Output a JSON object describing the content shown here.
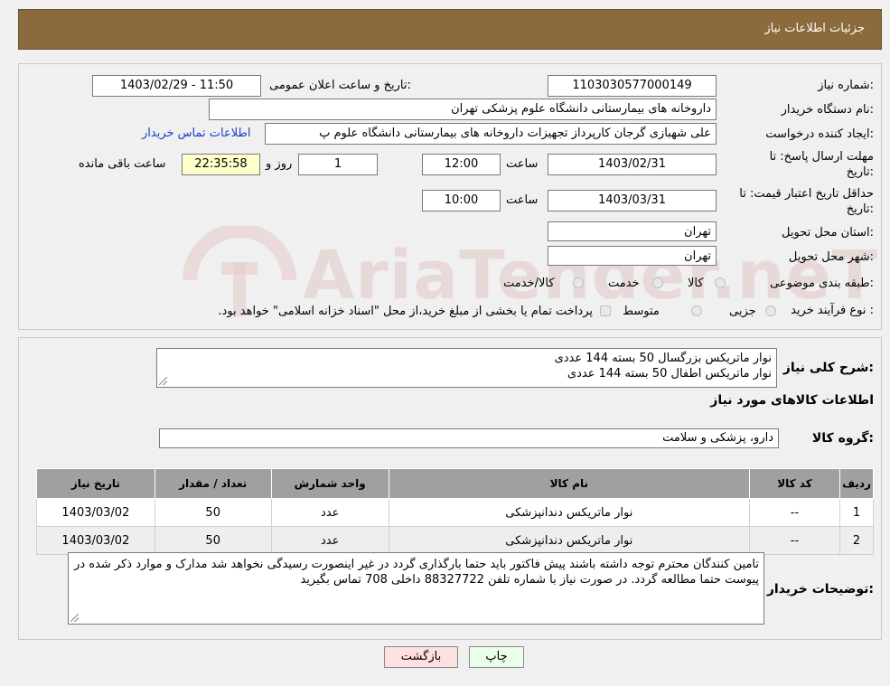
{
  "header": {
    "title": "جزئیات اطلاعات نیاز"
  },
  "form": {
    "need_number_label": "شماره نیاز:",
    "need_number": "1103030577000149",
    "announce_label": "تاریخ و ساعت اعلان عمومی:",
    "announce_value": "1403/02/29 - 11:50",
    "buyer_org_label": "نام دستگاه خریدار:",
    "buyer_org": "داروخانه های بیمارستانی دانشگاه علوم پزشکی تهران",
    "creator_label": "ایجاد کننده درخواست:",
    "creator": "علی شهبازی گرجان کارپرداز تجهیزات داروخانه های بیمارستانی دانشگاه علوم پ",
    "contact_link": "اطلاعات تماس خریدار",
    "deadline_label_1": "مهلت ارسال پاسخ: تا",
    "deadline_label_2": "تاریخ:",
    "deadline_date": "1403/02/31",
    "time_label": "ساعت",
    "deadline_time": "12:00",
    "days_value": "1",
    "days_label": "روز و",
    "remain_value": "22:35:58",
    "remain_label": "ساعت باقی مانده",
    "price_valid_label_1": "حداقل تاریخ اعتبار قیمت: تا",
    "price_valid_label_2": "تاریخ:",
    "price_valid_date": "1403/03/31",
    "price_valid_time": "10:00",
    "province_label": "استان محل تحویل:",
    "province": "تهران",
    "city_label": "شهر محل تحویل:",
    "city": "تهران",
    "category_label": "طبقه بندی موضوعی:",
    "category_options": [
      "کالا",
      "خدمت",
      "کالا/خدمت"
    ],
    "process_label": "نوع فرآیند خرید :",
    "process_options": [
      "جزیی",
      "متوسط"
    ],
    "process_note": "پرداخت تمام یا بخشی از مبلغ خرید،از محل \"اسناد خزانه اسلامی\" خواهد بود."
  },
  "description": {
    "label": "شرح کلی نیاز:",
    "lines": [
      "نوار ماتریکس بزرگسال 50 بسته 144 عددی",
      "نوار ماتریکس اطفال 50 بسته 144 عددی"
    ]
  },
  "goods": {
    "section_title": "اطلاعات کالاهای مورد نیاز",
    "group_label": "گروه کالا:",
    "group_value": "دارو، پزشکی و سلامت",
    "columns": [
      "ردیف",
      "کد کالا",
      "نام کالا",
      "واحد شمارش",
      "تعداد / مقدار",
      "تاریخ نیاز"
    ],
    "rows": [
      [
        "1",
        "--",
        "نوار ماتریکس دندانپزشکی",
        "عدد",
        "50",
        "1403/03/02"
      ],
      [
        "2",
        "--",
        "نوار ماتریکس دندانپزشکی",
        "عدد",
        "50",
        "1403/03/02"
      ]
    ]
  },
  "notes": {
    "label": "توضیحات خریدار:",
    "text": "تامین کنندگان محترم توجه داشته باشند پیش فاکتور باید حتما بارگذاری گردد در غیر اینصورت رسیدگی نخواهد شد مدارک و موارد ذکر شده در پیوست حتما مطالعه گردد. در صورت نیاز با شماره تلفن 88327722 داخلی 708 تماس بگیرید"
  },
  "buttons": {
    "print": "چاپ",
    "back": "بازگشت"
  },
  "watermark": "AriaTender.neT",
  "colors": {
    "header": "#8b6b3d",
    "link": "#1a3fc7",
    "back_button": "#ffe0e0",
    "print_button": "#eaffea",
    "remain_bg": "#ffffcc"
  }
}
